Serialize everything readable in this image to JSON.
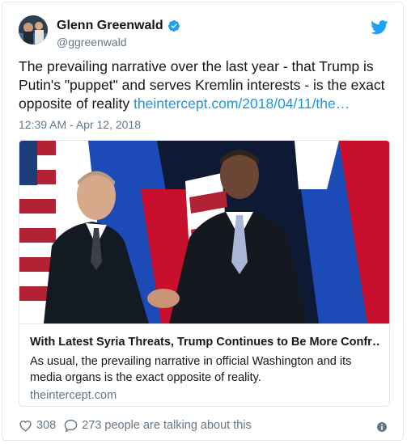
{
  "author": {
    "display_name": "Glenn Greenwald",
    "handle": "@ggreenwald"
  },
  "icons": {
    "verified": "verified-badge-icon",
    "bird": "twitter-bird-icon",
    "heart": "heart-icon",
    "comment": "comment-bubble-icon",
    "info": "info-icon"
  },
  "tweet": {
    "text": "The prevailing narrative over the last year - that Trump is Putin's \"puppet\" and serves Kremlin interests - is the exact opposite of reality",
    "link_text": "theintercept.com/2018/04/11/the…",
    "timestamp": "12:39 AM - Apr 12, 2018"
  },
  "link_card": {
    "title": "With Latest Syria Threats, Trump Continues to Be More Confr…",
    "description": "As usual, the prevailing narrative in official Washington and its media organs is the exact opposite of reality.",
    "domain": "theintercept.com"
  },
  "footer": {
    "likes": "308",
    "talking": "273 people are talking about this"
  },
  "colors": {
    "accent": "#1da1f2",
    "link": "#1b95e0",
    "text": "#14171a",
    "muted": "#657786",
    "border": "#e1e8ed"
  }
}
